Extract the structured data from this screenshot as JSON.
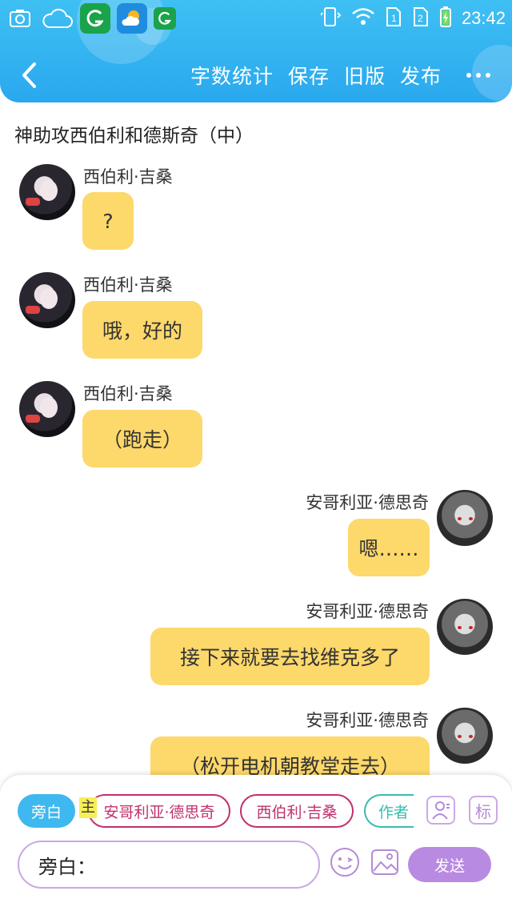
{
  "statusbar": {
    "time": "23:42",
    "left_icons": [
      "screenshot-icon",
      "cloud-icon",
      "app-green-icon",
      "weather-icon",
      "app-green-small-icon"
    ],
    "right_icons": [
      "phone-vibrate-icon",
      "wifi-icon",
      "sim1-icon",
      "sim2-icon",
      "battery-charging-icon"
    ]
  },
  "header": {
    "actions": [
      "字数统计",
      "保存",
      "旧版",
      "发布"
    ],
    "more_label": "更多"
  },
  "story": {
    "title": "神助攻西伯利和德斯奇（中）"
  },
  "messages": [
    {
      "side": "left",
      "speaker": "西伯利·吉桑",
      "text": "?"
    },
    {
      "side": "left",
      "speaker": "西伯利·吉桑",
      "text": "哦，好的"
    },
    {
      "side": "left",
      "speaker": "西伯利·吉桑",
      "text": "（跑走）"
    },
    {
      "side": "right",
      "speaker": "安哥利亚·德思奇",
      "text": "嗯……"
    },
    {
      "side": "right",
      "speaker": "安哥利亚·德思奇",
      "text": "接下来就要去找维克多了"
    },
    {
      "side": "right",
      "speaker": "安哥利亚·德思奇",
      "text": "（松开电机朝教堂走去）"
    }
  ],
  "composer": {
    "roles": {
      "narration": "旁白",
      "main_tag": "主",
      "role_a": "安哥利亚·德思奇",
      "role_b": "西伯利·吉桑",
      "role_c": "作者"
    },
    "mark_label": "标",
    "input_value": "旁白：",
    "send_label": "发送"
  },
  "colors": {
    "header": "#2aa8ee",
    "bubble": "#fdd86b",
    "send": "#b98ae2",
    "role_chip": "#c2306e",
    "author_chip": "#39bbb1"
  }
}
